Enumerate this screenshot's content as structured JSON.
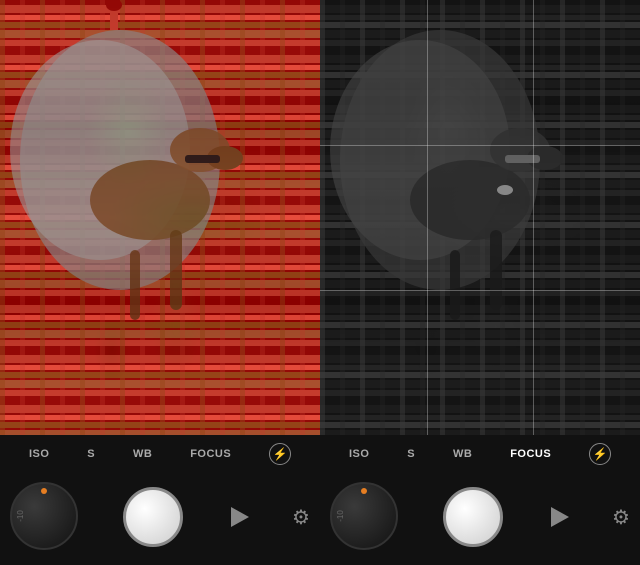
{
  "panels": [
    {
      "id": "color",
      "type": "color",
      "labels": {
        "iso": "ISO",
        "s": "S",
        "wb": "WB",
        "focus": "FOCUS"
      },
      "flash_icon": "✕",
      "dial": {
        "dot_color": "#e67e22",
        "label": "-10"
      },
      "buttons": {
        "play": "▶",
        "gear": "⚙"
      }
    },
    {
      "id": "bw",
      "type": "bw",
      "labels": {
        "iso": "ISO",
        "s": "S",
        "wb": "WB",
        "focus": "FOcUS"
      },
      "flash_icon": "✕",
      "dial": {
        "dot_color": "#e67e22",
        "label": "-10"
      },
      "buttons": {
        "play": "▶",
        "gear": "⚙"
      }
    }
  ]
}
